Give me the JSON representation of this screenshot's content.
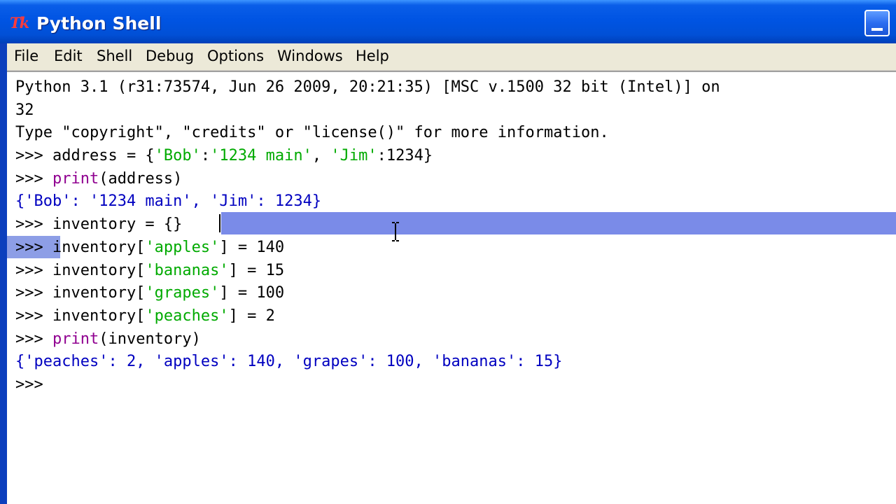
{
  "window": {
    "title": "Python Shell",
    "logo": "Tk",
    "controls": {
      "minimize_icon": "minimize-icon"
    }
  },
  "menubar": {
    "items": [
      "File",
      "Edit",
      "Shell",
      "Debug",
      "Options",
      "Windows",
      "Help"
    ]
  },
  "shell": {
    "lines": [
      [
        {
          "t": "Python 3.1 (r31:73574, Jun 26 2009, 20:21:35) [MSC v.1500 32 bit (Intel)] on",
          "c": "plain"
        }
      ],
      [
        {
          "t": "32",
          "c": "plain"
        }
      ],
      [
        {
          "t": "Type \"copyright\", \"credits\" or \"license()\" for more information.",
          "c": "plain"
        }
      ],
      [
        {
          "t": ">>> address = {",
          "c": "plain"
        },
        {
          "t": "'Bob'",
          "c": "str"
        },
        {
          "t": ":",
          "c": "plain"
        },
        {
          "t": "'1234 main'",
          "c": "str"
        },
        {
          "t": ", ",
          "c": "plain"
        },
        {
          "t": "'Jim'",
          "c": "str"
        },
        {
          "t": ":1234}",
          "c": "plain"
        }
      ],
      [
        {
          "t": ">>> ",
          "c": "plain"
        },
        {
          "t": "print",
          "c": "kw"
        },
        {
          "t": "(address)",
          "c": "plain"
        }
      ],
      [
        {
          "t": "{'Bob': '1234 main', 'Jim': 1234}",
          "c": "out"
        }
      ],
      [
        {
          "t": ">>> inventory = {}",
          "c": "plain"
        }
      ],
      [
        {
          "t": ">>> inventory[",
          "c": "plain"
        },
        {
          "t": "'apples'",
          "c": "str"
        },
        {
          "t": "] = 140",
          "c": "plain"
        }
      ],
      [
        {
          "t": ">>> inventory[",
          "c": "plain"
        },
        {
          "t": "'bananas'",
          "c": "str"
        },
        {
          "t": "] = 15",
          "c": "plain"
        }
      ],
      [
        {
          "t": ">>> inventory[",
          "c": "plain"
        },
        {
          "t": "'grapes'",
          "c": "str"
        },
        {
          "t": "] = 100",
          "c": "plain"
        }
      ],
      [
        {
          "t": ">>> inventory[",
          "c": "plain"
        },
        {
          "t": "'peaches'",
          "c": "str"
        },
        {
          "t": "] = 2",
          "c": "plain"
        }
      ],
      [
        {
          "t": ">>> ",
          "c": "plain"
        },
        {
          "t": "print",
          "c": "kw"
        },
        {
          "t": "(inventory)",
          "c": "plain"
        }
      ],
      [
        {
          "t": "{'peaches': 2, 'apples': 140, 'grapes': 100, 'bananas': 15}",
          "c": "out"
        }
      ],
      [
        {
          "t": ">>> ",
          "c": "plain"
        }
      ]
    ]
  },
  "colors": {
    "titlebar": "#0054e3",
    "menubar": "#ece9d8",
    "string": "#00aa00",
    "keyword": "#900090",
    "output": "#0000c0",
    "selection": "#7a8be8"
  }
}
